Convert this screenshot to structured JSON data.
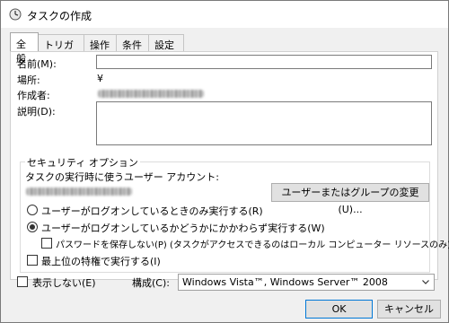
{
  "window": {
    "title": "タスクの作成"
  },
  "tabs": [
    {
      "label": "全般"
    },
    {
      "label": "トリガー"
    },
    {
      "label": "操作"
    },
    {
      "label": "条件"
    },
    {
      "label": "設定"
    }
  ],
  "general": {
    "name_label": "名前(M):",
    "name_value": "",
    "location_label": "場所:",
    "location_value": "¥",
    "author_label": "作成者:",
    "description_label": "説明(D):",
    "description_value": ""
  },
  "security": {
    "group_title": "セキュリティ オプション",
    "account_label": "タスクの実行時に使うユーザー アカウント:",
    "change_user_button": "ユーザーまたはグループの変更(U)...",
    "radio_logged_on_only": "ユーザーがログオンしているときのみ実行する(R)",
    "radio_logged_on_or_not": "ユーザーがログオンしているかどうかにかかわらず実行する(W)",
    "radio_selected": "logged_on_or_not",
    "checkbox_no_password": "パスワードを保存しない(P) (タスクがアクセスできるのはローカル コンピューター リソースのみ)",
    "checkbox_no_password_checked": false,
    "checkbox_highest": "最上位の特権で実行する(I)",
    "checkbox_highest_checked": false
  },
  "footer": {
    "hidden_label": "表示しない(E)",
    "hidden_checked": false,
    "configure_label": "構成(C):",
    "configure_value": "Windows Vista™, Windows Server™ 2008",
    "ok_button": "OK",
    "cancel_button": "キャンセル"
  },
  "icons": {
    "window_icon": "task-clock-icon",
    "dropdown_icon": "chevron-down-icon"
  }
}
